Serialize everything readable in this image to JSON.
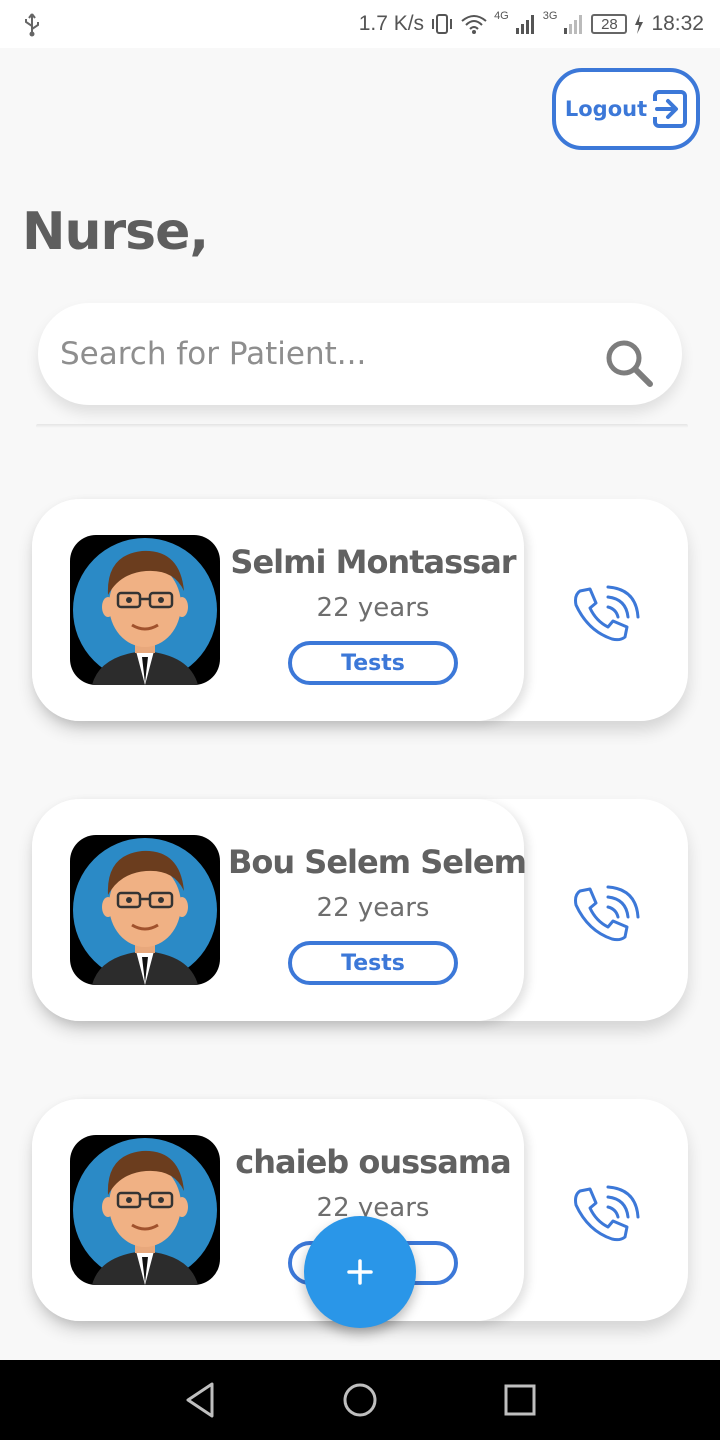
{
  "status_bar": {
    "speed": "1.7 K/s",
    "signal_4g": "4G",
    "signal_3g": "3G",
    "battery": "28",
    "time": "18:32",
    "icons": [
      "usb-icon",
      "vibrate-icon",
      "wifi-icon",
      "signal-icon",
      "battery-icon",
      "charging-icon"
    ]
  },
  "header": {
    "logout_label": "Logout",
    "title": "Nurse,"
  },
  "search": {
    "placeholder": "Search for Patient..."
  },
  "patients": [
    {
      "name": "Selmi Montassar",
      "age": "22 years",
      "tests_label": "Tests"
    },
    {
      "name": "Bou Selem Selem",
      "age": "22 years",
      "tests_label": "Tests"
    },
    {
      "name": "chaieb oussama",
      "age": "22 years",
      "tests_label": "Tests"
    }
  ],
  "fab": {
    "icon": "plus-icon"
  },
  "colors": {
    "accent": "#3c78d8",
    "fab": "#2a96e8",
    "title": "#5e5e5e",
    "background": "#f8f8f8"
  }
}
